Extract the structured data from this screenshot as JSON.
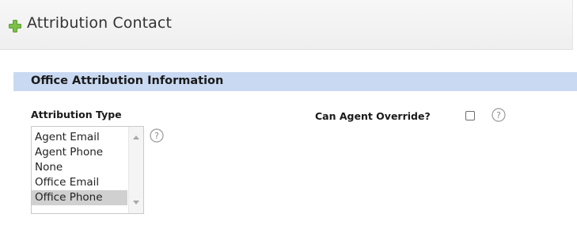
{
  "header": {
    "title": "Attribution Contact",
    "icon": "plus-icon",
    "icon_color": "#5aa02c"
  },
  "section": {
    "title": "Office Attribution Information",
    "bar_color": "#c9d9f2"
  },
  "fields": {
    "attribution_type": {
      "label": "Attribution Type",
      "options": [
        "Agent Email",
        "Agent Phone",
        "None",
        "Office Email",
        "Office Phone"
      ],
      "selected": "Office Phone"
    },
    "can_agent_override": {
      "label": "Can Agent Override?",
      "checked": false
    }
  }
}
